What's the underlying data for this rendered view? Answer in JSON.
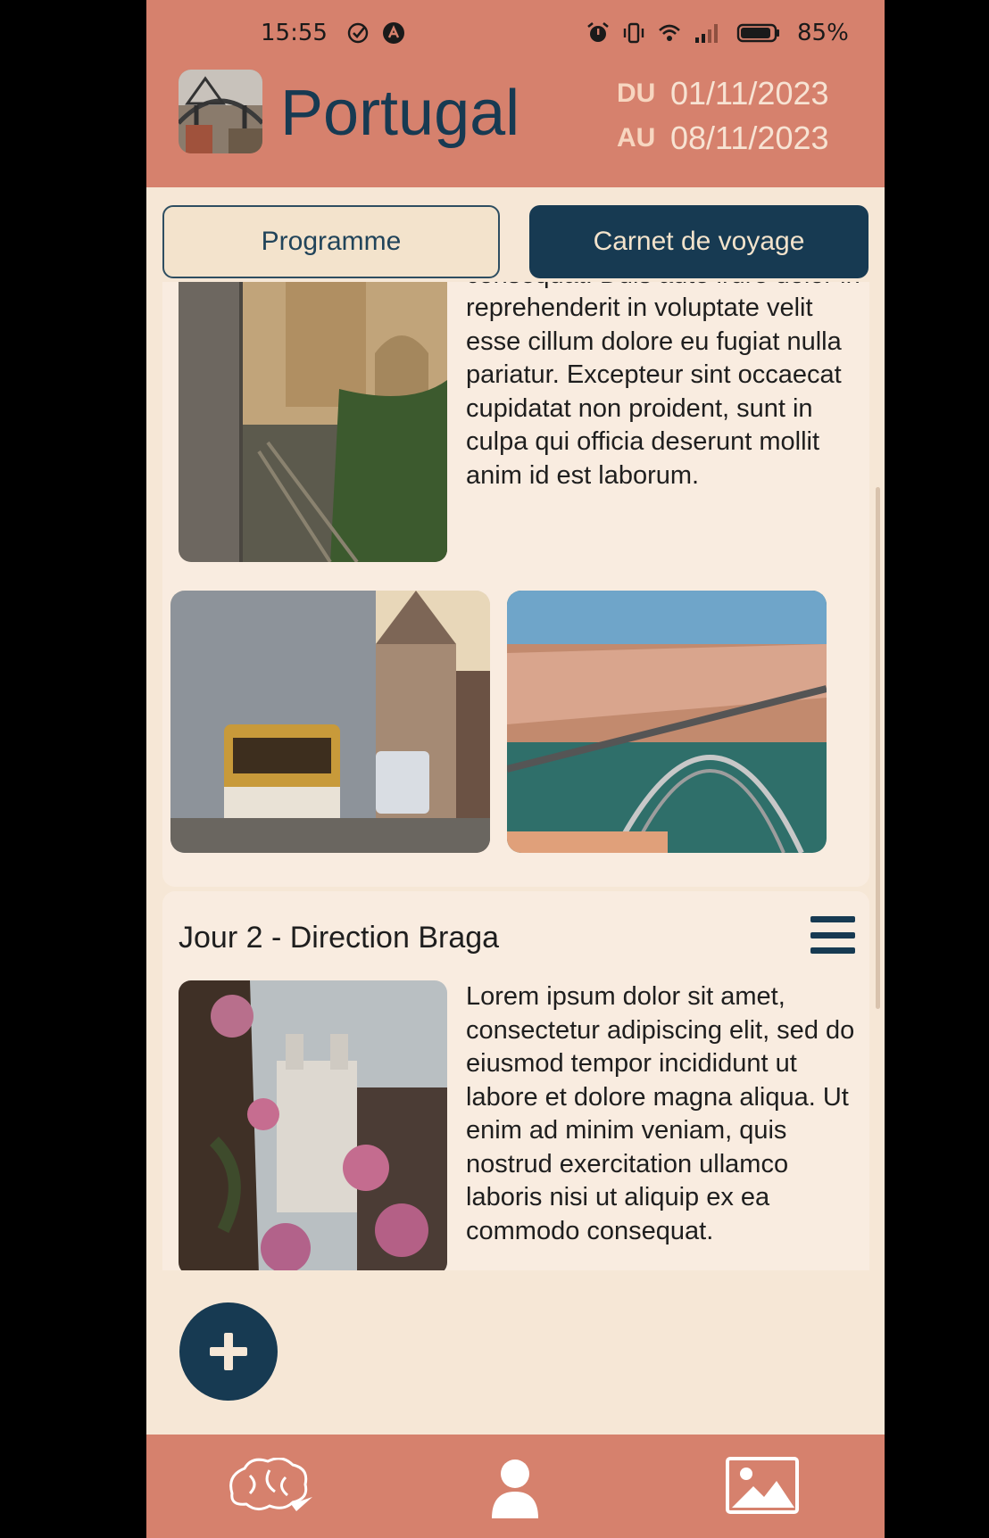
{
  "status_bar": {
    "time": "15:55",
    "battery": "85%"
  },
  "header": {
    "title": "Portugal",
    "date_from_label": "DU",
    "date_from": "01/11/2023",
    "date_to_label": "AU",
    "date_to": "08/11/2023"
  },
  "tabs": [
    {
      "label": "Programme",
      "active": false
    },
    {
      "label": "Carnet de voyage",
      "active": true
    }
  ],
  "days": [
    {
      "text": "nisi ut aliquip ex ea commodo consequat. Duis aute irure dolor in reprehenderit in voluptate velit esse cillum dolore eu fugiat nulla pariatur. Excepteur sint occaecat cupidatat non proident, sunt in culpa qui officia deserunt mollit anim id est laborum."
    },
    {
      "title": "Jour 2 - Direction Braga",
      "text": "Lorem ipsum dolor sit amet, consectetur adipiscing elit, sed do eiusmod tempor incididunt ut labore et dolore magna aliqua. Ut enim ad minim veniam, quis nostrud exercitation ullamco laboris nisi ut aliquip ex ea commodo consequat."
    }
  ],
  "icons": {
    "fab": "plus-icon",
    "nav": [
      "brain-plane-icon",
      "user-icon",
      "image-icon"
    ],
    "day_menu": "hamburger-menu-icon"
  },
  "colors": {
    "header": "#d6816d",
    "navy": "#173a52",
    "background": "#f6e7d6",
    "card": "#f9ece0"
  }
}
